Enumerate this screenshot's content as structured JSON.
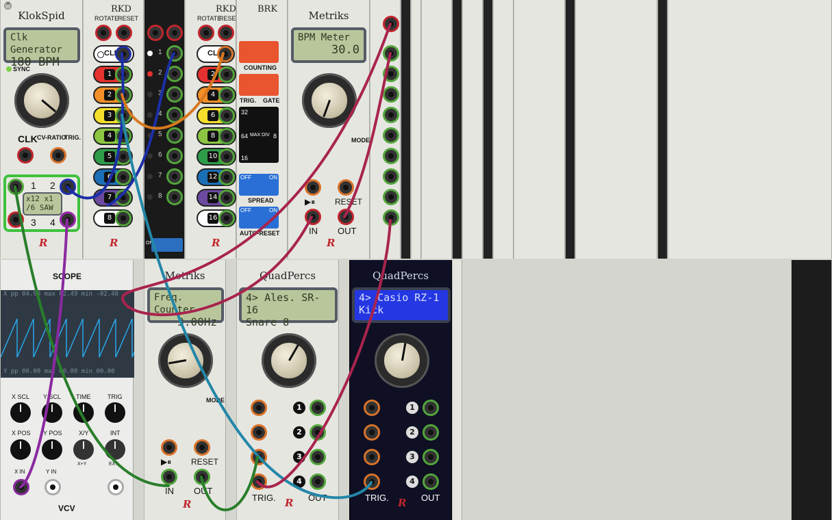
{
  "klokspid": {
    "title": "KlokSpid",
    "lcd_line1": "Clk Generator",
    "lcd_line2": "180 BPM",
    "sync": "SYNC",
    "clk": "CLK",
    "cv_ratio": "CV-RATIO",
    "trig": "TRIG.",
    "ratio_lcd1": "x12 x1",
    "ratio_lcd2": "/6 SAW",
    "out1": "1",
    "out2": "2",
    "out3": "3",
    "out4": "4"
  },
  "rkd1": {
    "title": "RKD",
    "rotate": "ROTATE",
    "reset": "RESET",
    "clk": "CLK",
    "rows": [
      "1",
      "2",
      "3",
      "4",
      "5",
      "6",
      "7",
      "8"
    ]
  },
  "rkd2": {
    "title": "RKD",
    "rotate": "ROTATE",
    "reset": "RESET",
    "clk": "CLK",
    "rows": [
      "2",
      "4",
      "6",
      "8",
      "10",
      "12",
      "14",
      "16"
    ]
  },
  "gates": {
    "rows": [
      "1",
      "2",
      "3",
      "4",
      "5",
      "6",
      "7",
      "8"
    ],
    "on": "ON"
  },
  "brk": {
    "title": "BRK",
    "counting": "COUNTING",
    "trig": "TRIG.",
    "gate": "GATE",
    "n32": "32",
    "n64": "64",
    "maxdiv": "MAX DIV",
    "n8": "8",
    "n16": "16",
    "off": "OFF",
    "on": "ON",
    "spread": "SPREAD",
    "autoreset": "AUTO-RESET"
  },
  "metriks1": {
    "title": "Metriks",
    "lcd_line1": "BPM Meter",
    "lcd_line2": "30.0",
    "mode": "MODE",
    "play": "▶⏸",
    "reset": "RESET",
    "in": "IN",
    "out": "OUT"
  },
  "scope": {
    "title": "SCOPE",
    "top_readout": "X  pp  04.98  max  02.49  min  -02.48",
    "bottom_readout": "Y  pp  00.00  max  00.00  min  00.00",
    "xscl": "X SCL",
    "yscl": "Y SCL",
    "time": "TIME",
    "trig": "TRIG",
    "xpos": "X POS",
    "ypos": "Y POS",
    "xy": "X/Y",
    "int": "INT",
    "xpy": "X+Y",
    "ext": "EXT",
    "xin": "X IN",
    "yin": "Y IN",
    "brand": "VCV"
  },
  "metriks2": {
    "title": "Metriks",
    "lcd_line1": "Freq. Counter",
    "lcd_line2": "3.00Hz",
    "mode": "MODE",
    "play": "▶⏸",
    "reset": "RESET",
    "in": "IN",
    "out": "OUT"
  },
  "quad1": {
    "title": "QuadPercs",
    "lcd_line1": "4> Ales. SR-16",
    "lcd_line2": "Snare 8",
    "rows": [
      "1",
      "2",
      "3",
      "4"
    ],
    "trig": "TRIG.",
    "out": "OUT"
  },
  "quad2": {
    "title": "QuadPercs",
    "lcd_line1": "4> Casio RZ-1",
    "lcd_line2": "Kick",
    "rows": [
      "1",
      "2",
      "3",
      "4"
    ],
    "trig": "TRIG.",
    "out": "OUT"
  },
  "logo_mark": "R",
  "colors": {
    "cable_red": "#a8244d",
    "cable_blue": "#1c2fa8",
    "cable_orange": "#d6781f",
    "cable_green": "#2a7e2b",
    "cable_purple": "#8a2aa0",
    "cable_teal": "#2387a8"
  }
}
